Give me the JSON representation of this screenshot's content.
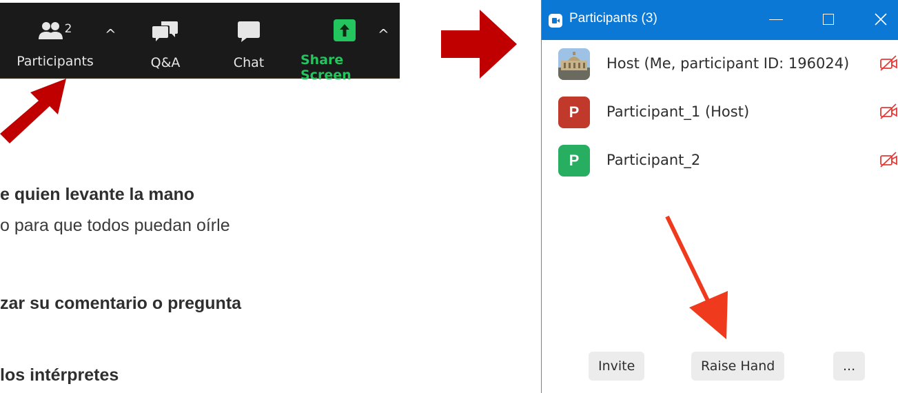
{
  "toolbar": {
    "participants_count": "2",
    "participants_label": "Participants",
    "qa_label": "Q&A",
    "chat_label": "Chat",
    "share_label": "Share Screen",
    "caret": "^"
  },
  "slide": {
    "line1_bold": "e quien levante la mano",
    "line2": "o para que todos puedan oírle",
    "line3_bold": "zar su comentario o pregunta",
    "line4_bold": "los intérpretes"
  },
  "window": {
    "title": "Participants (3)",
    "participants": [
      {
        "name": "Host (Me, participant ID: 196024)",
        "avatar_type": "photo",
        "initial": ""
      },
      {
        "name": "Participant_1 (Host)",
        "avatar_type": "letter",
        "initial": "P",
        "color": "#c0392b"
      },
      {
        "name": "Participant_2",
        "avatar_type": "letter",
        "initial": "P",
        "color": "#27ae60"
      }
    ],
    "buttons": {
      "invite": "Invite",
      "raise_hand": "Raise Hand",
      "more": "..."
    }
  },
  "colors": {
    "title_bar": "#0a78d4",
    "arrow_dark_red": "#c00000",
    "arrow_red": "#f03a1e",
    "share_green": "#22c55e",
    "video_off_red": "#e53935"
  }
}
